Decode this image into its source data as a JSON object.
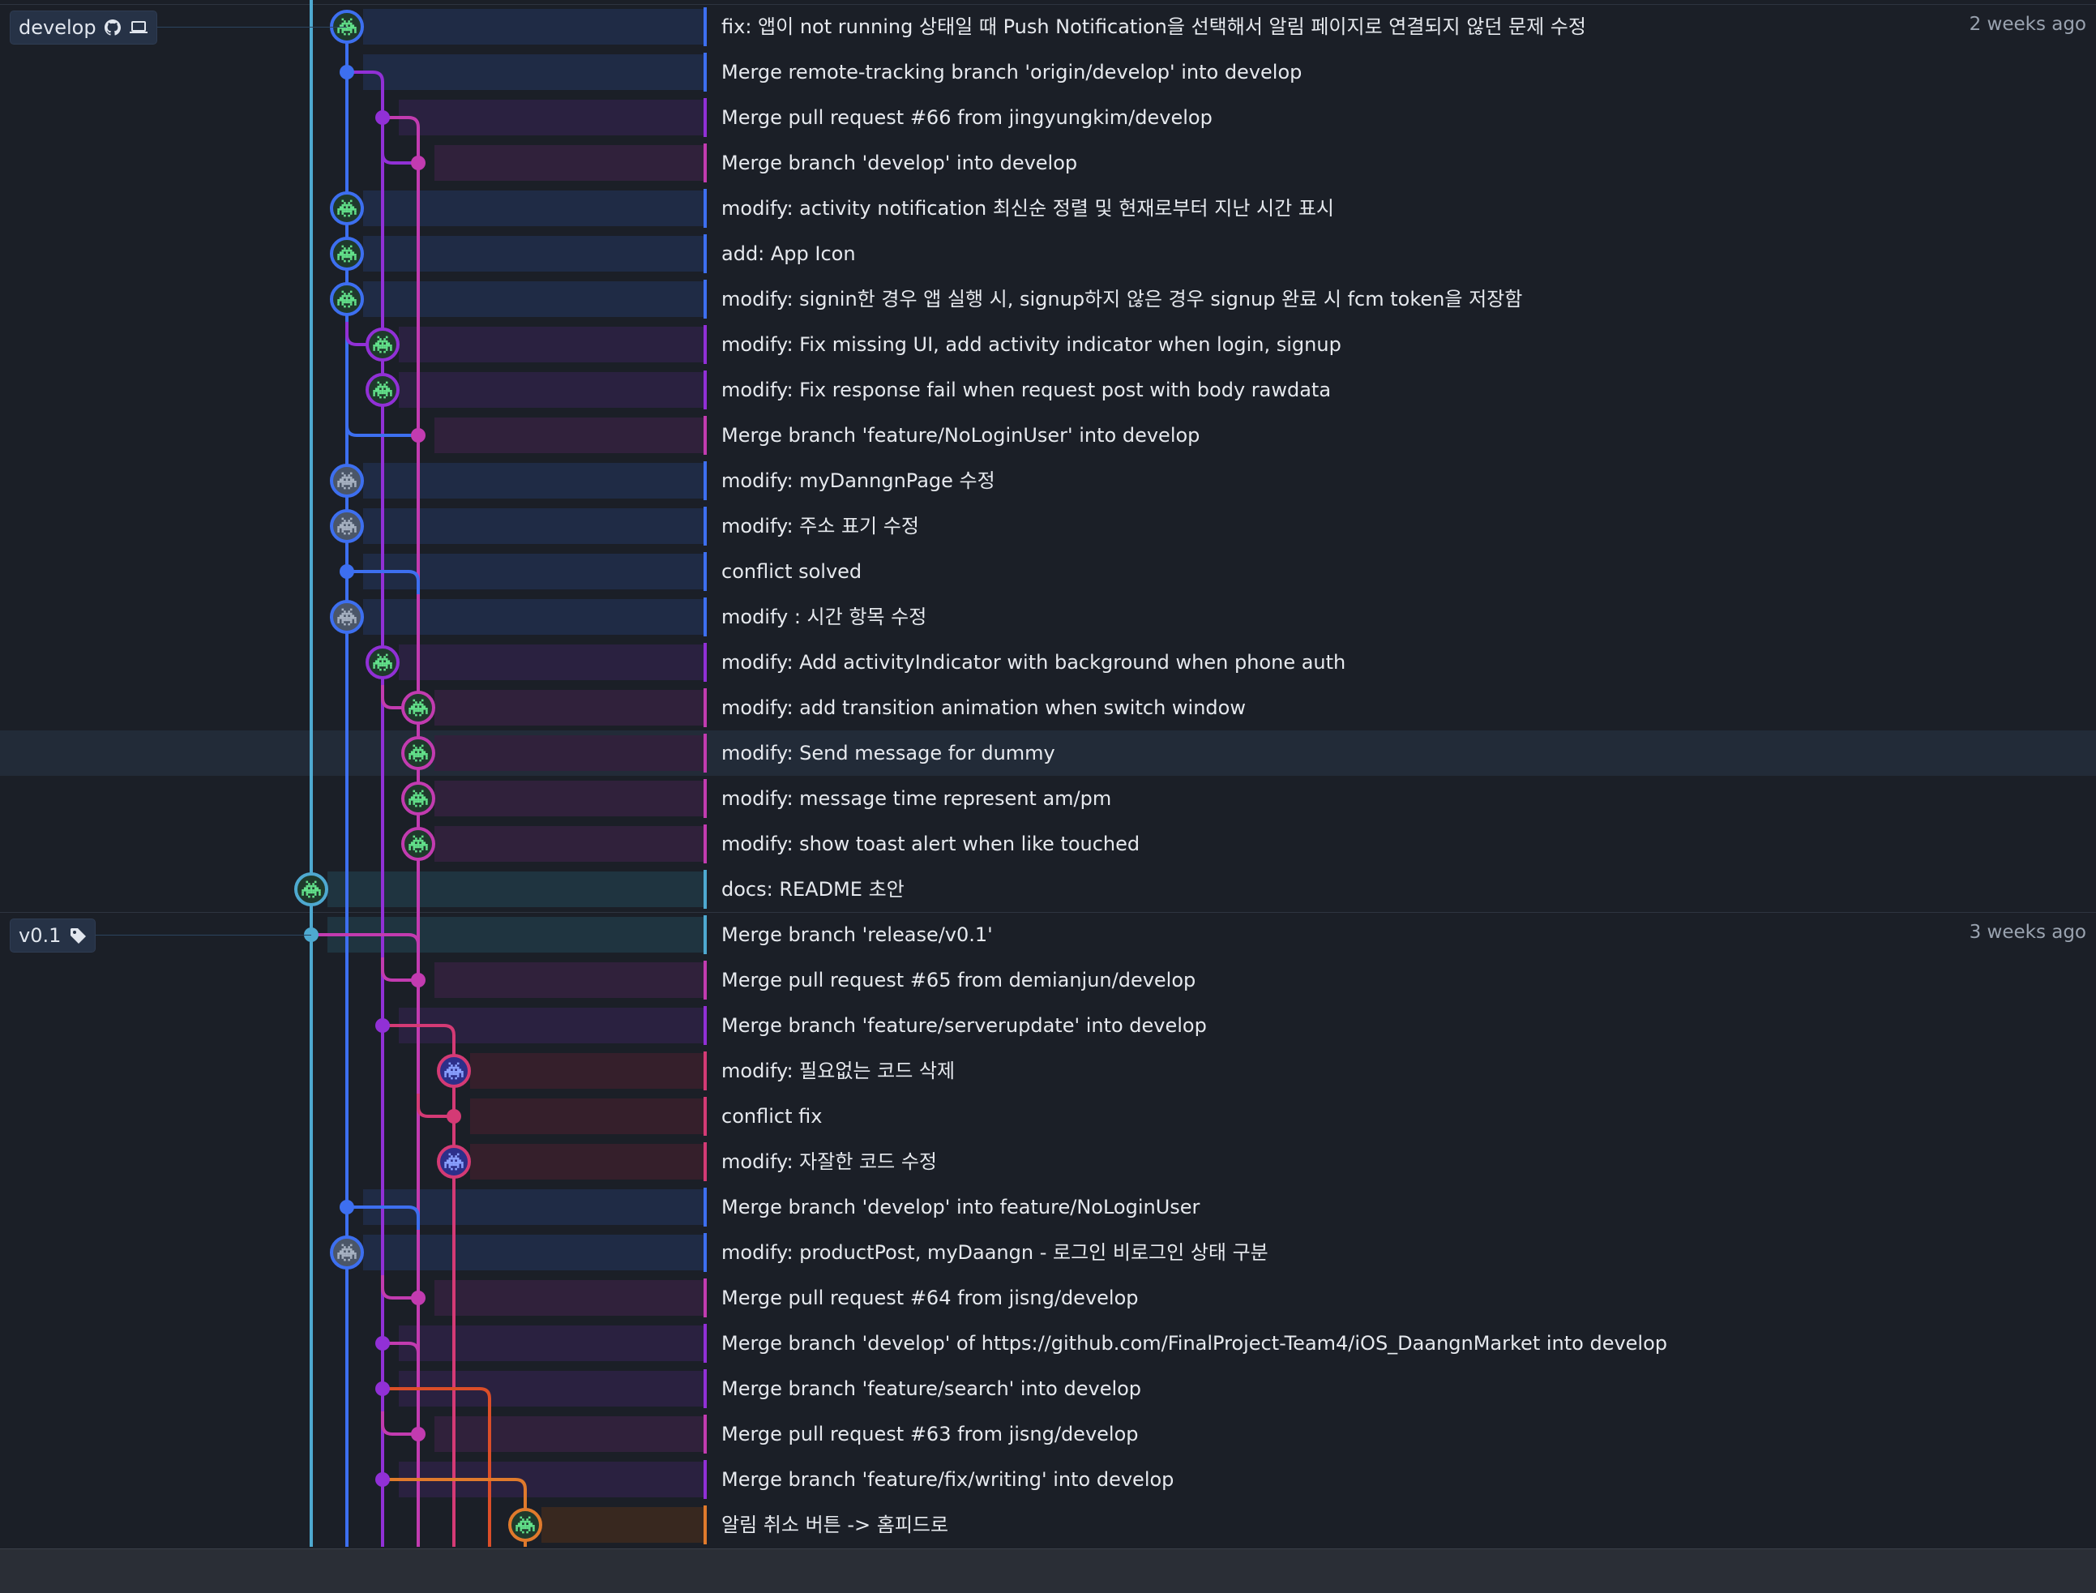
{
  "colors": {
    "lane0": "#4ea9d0",
    "lane1": "#3d6ff0",
    "lane2": "#9130d6",
    "lane3": "#c23bb0",
    "lane4": "#d43a75",
    "lane5": "#db4e28",
    "lane6": "#e07a2c"
  },
  "refs": [
    {
      "label": "develop",
      "icons": [
        "github-icon",
        "laptop-icon"
      ],
      "row": 0
    },
    {
      "label": "v0.1",
      "icons": [
        "tag-icon"
      ],
      "row": 20
    }
  ],
  "dates": [
    {
      "text": "2 weeks ago",
      "row": 0
    },
    {
      "text": "3 weeks ago",
      "row": 20
    }
  ],
  "commits": [
    {
      "message": "fix: 앱이 not running 상태일 때 Push Notification을 선택해서 알림 페이지로 연결되지 않던 문제 수정",
      "lane": 1,
      "node": "avatar-green"
    },
    {
      "message": "Merge remote-tracking branch 'origin/develop' into develop",
      "lane": 1,
      "node": "dot"
    },
    {
      "message": "Merge pull request #66 from jingyungkim/develop",
      "lane": 2,
      "node": "dot"
    },
    {
      "message": "Merge branch 'develop' into develop",
      "lane": 3,
      "node": "dot"
    },
    {
      "message": "modify: activity notification 최신순 정렬 및 현재로부터 지난 시간 표시",
      "lane": 1,
      "node": "avatar-green"
    },
    {
      "message": "add: App Icon",
      "lane": 1,
      "node": "avatar-green"
    },
    {
      "message": "modify: signin한 경우 앱 실행 시, signup하지 않은 경우 signup 완료 시 fcm token을 저장함",
      "lane": 1,
      "node": "avatar-green"
    },
    {
      "message": "modify: Fix missing UI, add activity indicator when login, signup",
      "lane": 2,
      "node": "avatar-green"
    },
    {
      "message": "modify: Fix response fail when request post with body rawdata",
      "lane": 2,
      "node": "avatar-green"
    },
    {
      "message": "Merge branch 'feature/NoLoginUser' into develop",
      "lane": 3,
      "node": "dot"
    },
    {
      "message": "modify: myDanngnPage 수정",
      "lane": 1,
      "node": "avatar-gray"
    },
    {
      "message": "modify: 주소 표기 수정",
      "lane": 1,
      "node": "avatar-gray"
    },
    {
      "message": "conflict solved",
      "lane": 1,
      "node": "dot"
    },
    {
      "message": "modify : 시간 항목 수정",
      "lane": 1,
      "node": "avatar-gray"
    },
    {
      "message": "modify: Add activityIndicator with background when phone auth",
      "lane": 2,
      "node": "avatar-green"
    },
    {
      "message": "modify: add transition animation when switch window",
      "lane": 3,
      "node": "avatar-green"
    },
    {
      "message": "modify: Send message for dummy",
      "lane": 3,
      "node": "avatar-green"
    },
    {
      "message": "modify: message time represent am/pm",
      "lane": 3,
      "node": "avatar-green"
    },
    {
      "message": "modify: show toast alert when like touched",
      "lane": 3,
      "node": "avatar-green"
    },
    {
      "message": "docs: README 초안",
      "lane": 0,
      "node": "avatar-green"
    },
    {
      "message": "Merge branch 'release/v0.1'",
      "lane": 0,
      "node": "dot"
    },
    {
      "message": "Merge pull request #65 from demianjun/develop",
      "lane": 3,
      "node": "dot"
    },
    {
      "message": "Merge branch 'feature/serverupdate' into develop",
      "lane": 2,
      "node": "dot"
    },
    {
      "message": "modify: 필요없는 코드 삭제",
      "lane": 4,
      "node": "avatar-blue"
    },
    {
      "message": "conflict fix",
      "lane": 4,
      "node": "dot"
    },
    {
      "message": "modify: 자잘한 코드 수정",
      "lane": 4,
      "node": "avatar-blue"
    },
    {
      "message": "Merge branch 'develop' into feature/NoLoginUser",
      "lane": 1,
      "node": "dot"
    },
    {
      "message": "modify: productPost, myDaangn - 로그인 비로그인 상태 구분",
      "lane": 1,
      "node": "avatar-gray"
    },
    {
      "message": "Merge pull request #64 from jisng/develop",
      "lane": 3,
      "node": "dot"
    },
    {
      "message": "Merge branch 'develop' of https://github.com/FinalProject-Team4/iOS_DaangnMarket into develop",
      "lane": 2,
      "node": "dot"
    },
    {
      "message": "Merge branch 'feature/search' into develop",
      "lane": 2,
      "node": "dot"
    },
    {
      "message": "Merge pull request #63 from jisng/develop",
      "lane": 3,
      "node": "dot"
    },
    {
      "message": "Merge branch 'feature/fix/writing' into develop",
      "lane": 2,
      "node": "dot"
    },
    {
      "message": "알림 취소 버튼 -> 홈피드로",
      "lane": 6,
      "node": "avatar-green"
    }
  ],
  "highlighted_row": 16
}
